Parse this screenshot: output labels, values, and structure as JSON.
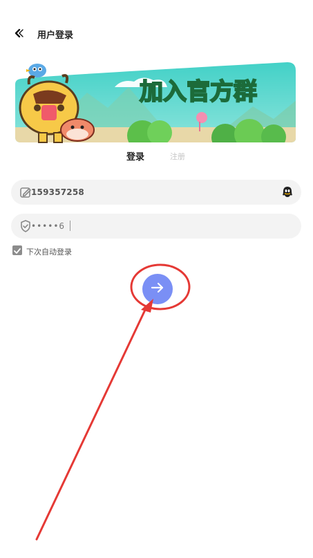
{
  "header": {
    "title": "用户登录",
    "back_icon": "chevron-left-icon"
  },
  "banner": {
    "text": "加入官方群",
    "colors": {
      "sky": "#4fd3c8",
      "text_fill": "#7ee8a6",
      "text_stroke": "#1c6b3a"
    }
  },
  "tabs": {
    "login": "登录",
    "register": "注册"
  },
  "form": {
    "phone_value": "159357258",
    "password_value": "•••••6",
    "remember_label": "下次自动登录",
    "remember_checked": true
  },
  "colors": {
    "accent": "#7a8ff5",
    "field_bg": "#f3f3f3",
    "annotation": "#e53935"
  }
}
